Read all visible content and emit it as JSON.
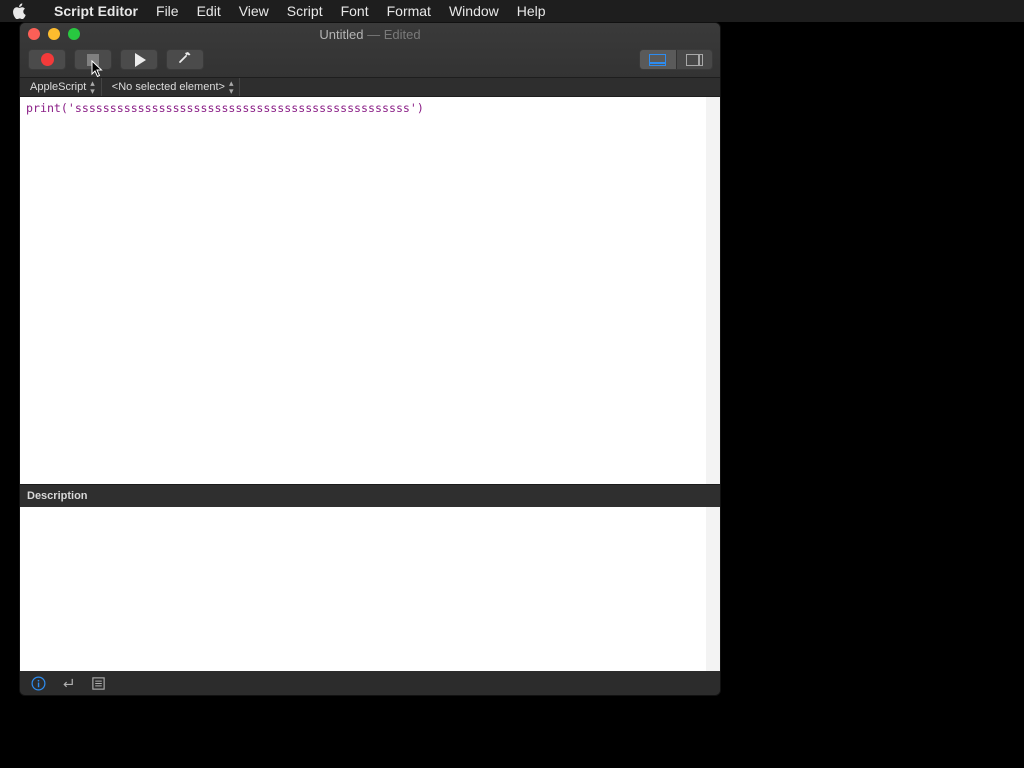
{
  "menubar": {
    "app_name": "Script Editor",
    "items": [
      "File",
      "Edit",
      "View",
      "Script",
      "Font",
      "Format",
      "Window",
      "Help"
    ]
  },
  "window": {
    "title": "Untitled",
    "title_status": "— Edited"
  },
  "toolbar": {
    "record_icon": "record-icon",
    "stop_icon": "stop-icon",
    "run_icon": "play-icon",
    "compile_icon": "hammer-icon",
    "view_toggle": [
      "show-bottom-pane-icon",
      "show-side-pane-icon"
    ]
  },
  "navbar": {
    "language": "AppleScript",
    "element": "<No selected element>"
  },
  "editor": {
    "code": "print('ssssssssssssssssssssssssssssssssssssssssssssssss')",
    "code_color": "#8b1f87"
  },
  "description": {
    "header": "Description"
  },
  "bottom_bar": {
    "icons": [
      "info-icon",
      "return-icon",
      "list-icon"
    ]
  },
  "colors": {
    "close": "#fc5f57",
    "minimize": "#fdbc2e",
    "maximize": "#28c840",
    "record": "#f33a3a",
    "accent": "#2d8cf0"
  }
}
